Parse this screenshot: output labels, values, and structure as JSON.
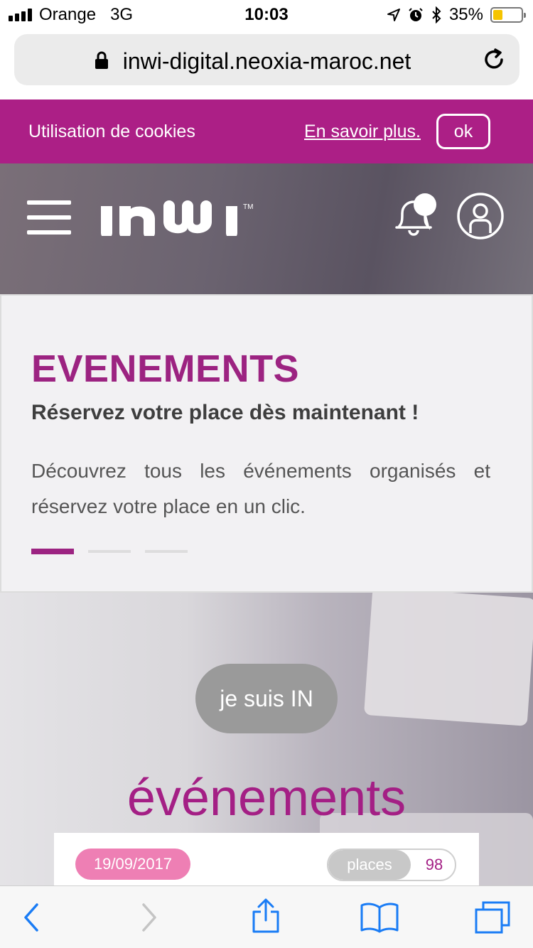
{
  "status_bar": {
    "carrier": "Orange",
    "network": "3G",
    "time": "10:03",
    "battery": "35%",
    "battery_level": 0.35
  },
  "browser": {
    "url": "inwi-digital.neoxia-maroc.net"
  },
  "cookie_banner": {
    "text": "Utilisation de cookies",
    "link": "En savoir plus.",
    "ok_label": "ok"
  },
  "hero": {
    "title": "EVENEMENTS",
    "subtitle": "Réservez votre place dès maintenant !",
    "description": "Découvrez tous les événements organisés et réservez votre place en un clic.",
    "active_slide": 1,
    "slide_count": 3
  },
  "events_section": {
    "cta_label": "je suis IN",
    "title": "événements",
    "card": {
      "date": "19/09/2017",
      "places_label": "places",
      "places_count": "98"
    }
  },
  "colors": {
    "brand": "#ac1f86",
    "title": "#9c2381",
    "date_badge": "#ee7fb4"
  }
}
